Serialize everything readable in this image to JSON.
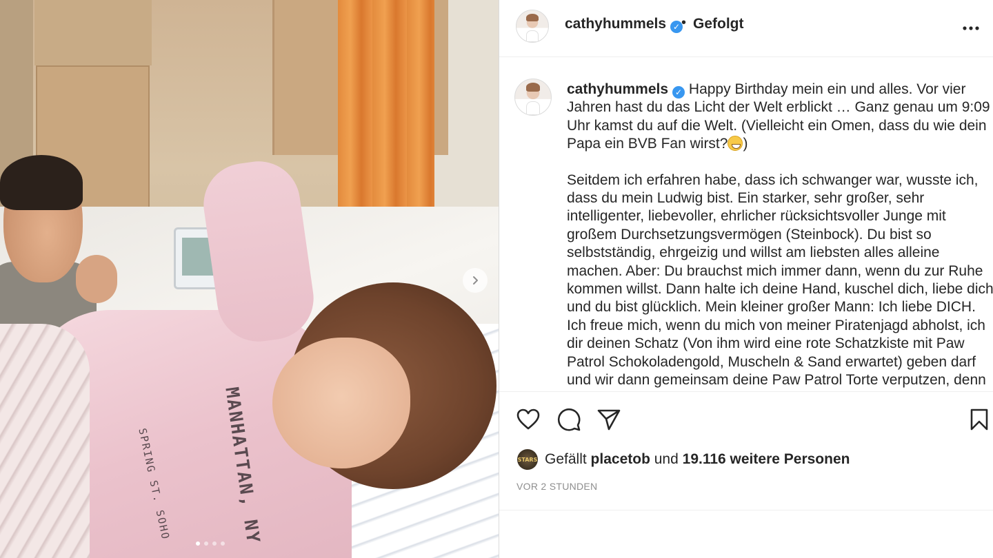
{
  "post": {
    "username": "cathyhummels",
    "verified_mark": "✓",
    "separator": "•",
    "follow_status": "Gefolgt",
    "more_icon": "more-horizontal-icon",
    "image_count": 4,
    "active_image": 1
  },
  "caption": {
    "username": "cathyhummels",
    "paragraph_1_text": "Happy Birthday mein ein und alles. Vor vier Jahren hast du das Licht der Welt erblickt … Ganz genau um 9:09 Uhr kamst du auf die Welt. (Vielleicht ein Omen, dass du wie dein Papa ein BVB Fan wirst?",
    "paragraph_1_end": ")",
    "paragraph_2": "Seitdem ich erfahren habe, dass ich schwanger war, wusste ich, dass du mein Ludwig bist. Ein starker, sehr großer, sehr intelligenter, liebevoller, ehrlicher rücksichtsvoller Junge mit großem Durchsetzungsvermögen (Steinbock). Du bist so selbstständig, ehrgeizig und willst am liebsten alles alleine machen. Aber: Du brauchst mich immer dann, wenn du zur Ruhe kommen willst. Dann halte ich deine Hand, kuschel dich, liebe dich und du bist glücklich. Mein kleiner großer Mann: Ich liebe DICH. Ich freue mich, wenn du mich von meiner Piratenjagd abholst, ich dir deinen Schatz (Von ihm wird eine rote Schatzkiste mit Paw Patrol Schokoladengold, Muscheln & Sand erwartet) geben darf und wir dann gemeinsam deine Paw Patrol Torte verputzen, denn dieses Jahr hast du"
  },
  "photo": {
    "shirt_text_1": "SPRING ST. SOHO",
    "shirt_text_2": "MANHATTAN, NY"
  },
  "actions": {
    "like_icon": "heart-icon",
    "comment_icon": "comment-icon",
    "share_icon": "paper-plane-icon",
    "save_icon": "bookmark-icon"
  },
  "likes": {
    "prefix": "Gefällt",
    "user": "placetob",
    "middle": "und",
    "count": "19.116 weitere Personen",
    "avatar_text": "STARS"
  },
  "timestamp": "VOR 2 STUNDEN",
  "colors": {
    "verified": "#3897f0",
    "text": "#262626",
    "muted": "#8e8e8e",
    "border": "#dbdbdb"
  }
}
